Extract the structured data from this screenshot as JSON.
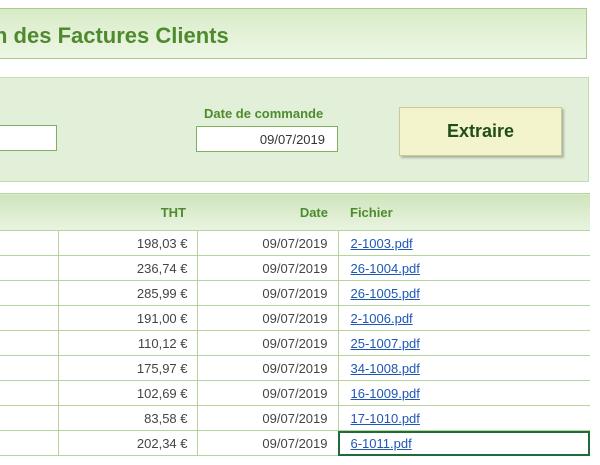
{
  "title": "n des Factures Clients",
  "filter": {
    "date_label": "Date de commande",
    "date_value": "09/07/2019",
    "left_input_value": "",
    "extract_label": "Extraire"
  },
  "table": {
    "headers": {
      "first": "",
      "tht": "THT",
      "date": "Date",
      "file": "Fichier"
    },
    "rows": [
      {
        "tht": "198,03 €",
        "date": "09/07/2019",
        "file": "2-1003.pdf"
      },
      {
        "tht": "236,74 €",
        "date": "09/07/2019",
        "file": "26-1004.pdf"
      },
      {
        "tht": "285,99 €",
        "date": "09/07/2019",
        "file": "26-1005.pdf"
      },
      {
        "tht": "191,00 €",
        "date": "09/07/2019",
        "file": "2-1006.pdf"
      },
      {
        "tht": "110,12 €",
        "date": "09/07/2019",
        "file": "25-1007.pdf"
      },
      {
        "tht": "175,97 €",
        "date": "09/07/2019",
        "file": "34-1008.pdf"
      },
      {
        "tht": "102,69 €",
        "date": "09/07/2019",
        "file": "16-1009.pdf"
      },
      {
        "tht": "83,58 €",
        "date": "09/07/2019",
        "file": "17-1010.pdf"
      },
      {
        "tht": "202,34 €",
        "date": "09/07/2019",
        "file": "6-1011.pdf"
      }
    ]
  },
  "colors": {
    "accent_green": "#4e8a2e",
    "link_blue": "#1f57b8",
    "button_bg": "#f3f3cc"
  }
}
